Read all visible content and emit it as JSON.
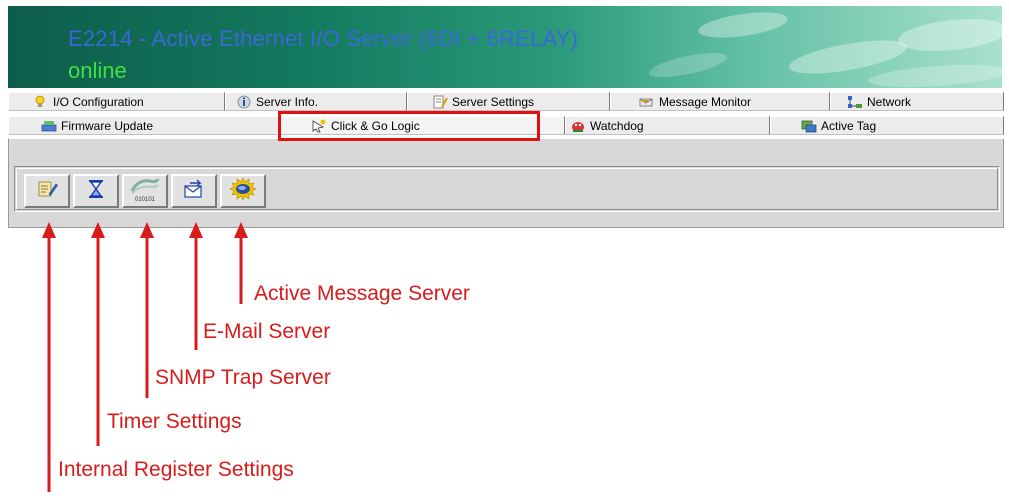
{
  "header": {
    "title": "E2214 - Active Ethernet I/O Server (6DI + 6RELAY)",
    "status": "online"
  },
  "tabs_row1": [
    {
      "label": "I/O Configuration",
      "icon": "bulb-icon"
    },
    {
      "label": "Server Info.",
      "icon": "globe-info-icon"
    },
    {
      "label": "Server Settings",
      "icon": "settings-sheet-icon"
    },
    {
      "label": "Message Monitor",
      "icon": "envelope-monitor-icon"
    },
    {
      "label": "Network",
      "icon": "network-icon"
    }
  ],
  "tabs_row2": [
    {
      "label": "Firmware Update",
      "icon": "firmware-icon"
    },
    {
      "label": "Click & Go Logic",
      "icon": "click-go-icon",
      "active": true
    },
    {
      "label": "Watchdog",
      "icon": "watchdog-icon"
    },
    {
      "label": "Active Tag",
      "icon": "active-tag-icon"
    }
  ],
  "toolbar": [
    {
      "name": "internal-register-button",
      "icon": "notepad-pencil-icon"
    },
    {
      "name": "timer-button",
      "icon": "hourglass-icon"
    },
    {
      "name": "snmp-trap-button",
      "icon": "snmp-binary-icon",
      "icon_text": "010101"
    },
    {
      "name": "email-server-button",
      "icon": "email-arrow-icon"
    },
    {
      "name": "active-message-button",
      "icon": "active-message-icon"
    }
  ],
  "callouts": {
    "active_message": "Active Message Server",
    "email": "E-Mail Server",
    "snmp": "SNMP Trap Server",
    "timer": "Timer Settings",
    "internal_register": "Internal Register Settings"
  },
  "colors": {
    "annotation_red": "#d81b1b",
    "title_blue": "#3b67d8",
    "status_green": "#3fe03f"
  }
}
